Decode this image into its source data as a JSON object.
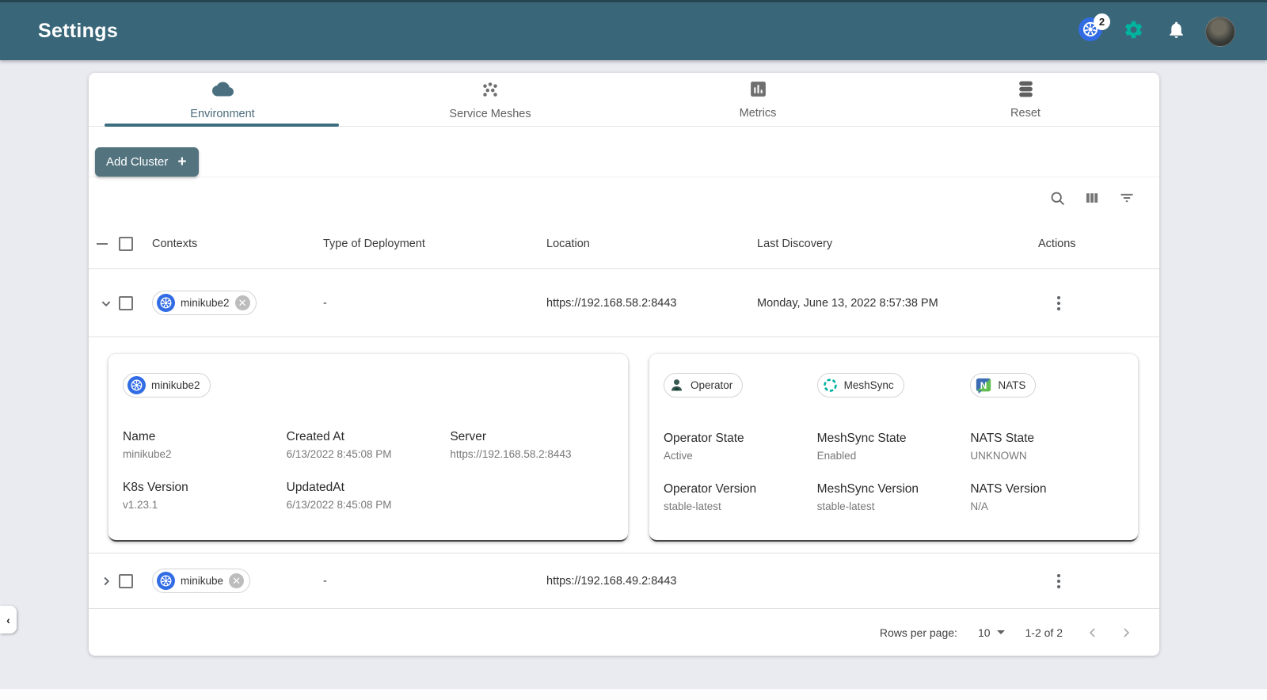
{
  "header": {
    "title": "Settings",
    "kubernetes_badge_count": "2",
    "icons": [
      "kubernetes-icon",
      "gear-icon",
      "bell-icon",
      "avatar"
    ]
  },
  "colors": {
    "appbar_bg": "#396679",
    "accent_teal": "#3c6e7f",
    "meshery_green": "#00B39F",
    "kubernetes_blue": "#326CE5",
    "button_bg": "#53747f"
  },
  "tabs": [
    {
      "label": "Environment",
      "icon": "cloud-icon",
      "active": true
    },
    {
      "label": "Service Meshes",
      "icon": "mesh-icon",
      "active": false
    },
    {
      "label": "Metrics",
      "icon": "bar-chart-icon",
      "active": false
    },
    {
      "label": "Reset",
      "icon": "database-icon",
      "active": false
    }
  ],
  "toolbar": {
    "add_cluster_label": "Add Cluster",
    "add_cluster_plus": "+",
    "icons": [
      "search-icon",
      "view-columns-icon",
      "filter-icon"
    ]
  },
  "table": {
    "columns": [
      "Contexts",
      "Type of Deployment",
      "Location",
      "Last Discovery",
      "Actions"
    ],
    "rows": [
      {
        "context": "minikube2",
        "type_of_deployment": "-",
        "location": "https://192.168.58.2:8443",
        "last_discovery": "Monday, June 13, 2022 8:57:38 PM",
        "expanded": true
      },
      {
        "context": "minikube",
        "type_of_deployment": "-",
        "location": "https://192.168.49.2:8443",
        "last_discovery": "",
        "expanded": false
      }
    ]
  },
  "expanded_details": {
    "cluster": {
      "chip_label": "minikube2",
      "fields": [
        {
          "label": "Name",
          "value": "minikube2"
        },
        {
          "label": "Created At",
          "value": "6/13/2022 8:45:08 PM"
        },
        {
          "label": "Server",
          "value": "https://192.168.58.2:8443"
        },
        {
          "label": "K8s Version",
          "value": "v1.23.1"
        },
        {
          "label": "UpdatedAt",
          "value": "6/13/2022 8:45:08 PM"
        }
      ]
    },
    "services": {
      "chips": [
        {
          "label": "Operator",
          "icon": "operator-icon"
        },
        {
          "label": "MeshSync",
          "icon": "meshsync-icon"
        },
        {
          "label": "NATS",
          "icon": "nats-icon"
        }
      ],
      "fields": [
        {
          "label": "Operator State",
          "value": "Active"
        },
        {
          "label": "MeshSync State",
          "value": "Enabled"
        },
        {
          "label": "NATS State",
          "value": "UNKNOWN"
        },
        {
          "label": "Operator Version",
          "value": "stable-latest"
        },
        {
          "label": "MeshSync Version",
          "value": "stable-latest"
        },
        {
          "label": "NATS Version",
          "value": "N/A"
        }
      ]
    }
  },
  "pagination": {
    "rows_per_page_label": "Rows per page:",
    "rows_per_page_value": "10",
    "range_label": "1-2 of 2"
  },
  "drawer_handle": "‹"
}
